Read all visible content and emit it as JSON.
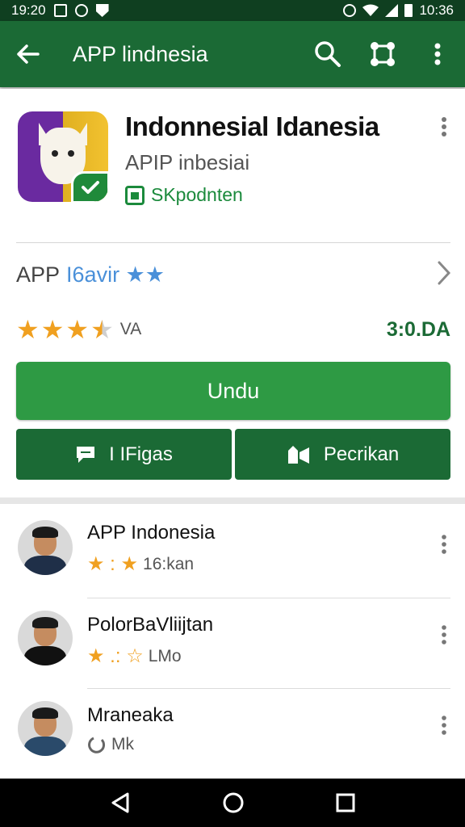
{
  "status_bar": {
    "time": "19:20",
    "clock": "10:36"
  },
  "toolbar": {
    "title": "APP lindnesia"
  },
  "app": {
    "title": "Indonnesial Idanesia",
    "subtitle": "APIP inbesiai",
    "developer": "SKpodnten"
  },
  "info_row": {
    "label_primary": "APP",
    "label_secondary": "I6avir ★★"
  },
  "rating": {
    "stars": 3.5,
    "count_label": "VA",
    "size": "3:0.DA"
  },
  "buttons": {
    "install": "Undu",
    "secondary_left": "I IFigas",
    "secondary_right": "Pecrikan"
  },
  "reviews": [
    {
      "name": "APP Indonesia",
      "stars": "★ : ★",
      "meta": "16:kan"
    },
    {
      "name": "PolorBaVliijtan",
      "stars": "★ .: ☆",
      "meta": "LMo"
    },
    {
      "name": "Mraneaka",
      "stars": "",
      "meta": "Mk"
    }
  ],
  "colors": {
    "toolbar": "#1b6a35",
    "accent": "#2e9a44",
    "star": "#f0a020"
  }
}
